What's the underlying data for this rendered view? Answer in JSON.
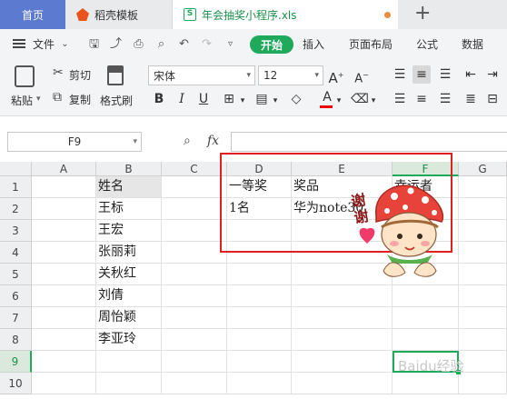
{
  "tabs": {
    "home": "首页",
    "docer": "稻壳模板",
    "file": "年会抽奖小程序.xls"
  },
  "menu": {
    "file": "文件",
    "start": "开始",
    "insert": "插入",
    "page_layout": "页面布局",
    "formula": "公式",
    "data": "数据"
  },
  "ribbon": {
    "paste": "粘贴",
    "cut": "剪切",
    "copy": "复制",
    "format_painter": "格式刷",
    "font_name": "宋体",
    "font_size": "12",
    "bold": "B",
    "italic": "I",
    "underline": "U",
    "font_color": "A"
  },
  "formula_bar": {
    "cell_ref": "F9",
    "fx": "fx",
    "value": ""
  },
  "columns": [
    "A",
    "B",
    "C",
    "D",
    "E",
    "F",
    "G"
  ],
  "rows": [
    "1",
    "2",
    "3",
    "4",
    "5",
    "6",
    "7",
    "8",
    "9",
    "10"
  ],
  "cells": {
    "B1": "姓名",
    "B2": "王标",
    "B3": "王宏",
    "B4": "张丽莉",
    "B5": "关秋红",
    "B6": "刘倩",
    "B7": "周怡颖",
    "B8": "李亚玲",
    "D1": "一等奖",
    "E1": "奖品",
    "F1": "幸运者",
    "D2": "1名",
    "E2": "华为note30"
  },
  "sticker_text": "谢谢",
  "watermark": "Baidu经验",
  "colors": {
    "accent_green": "#1fa95a",
    "home_tab": "#5b7ad0",
    "annotation_red": "#e02020"
  }
}
